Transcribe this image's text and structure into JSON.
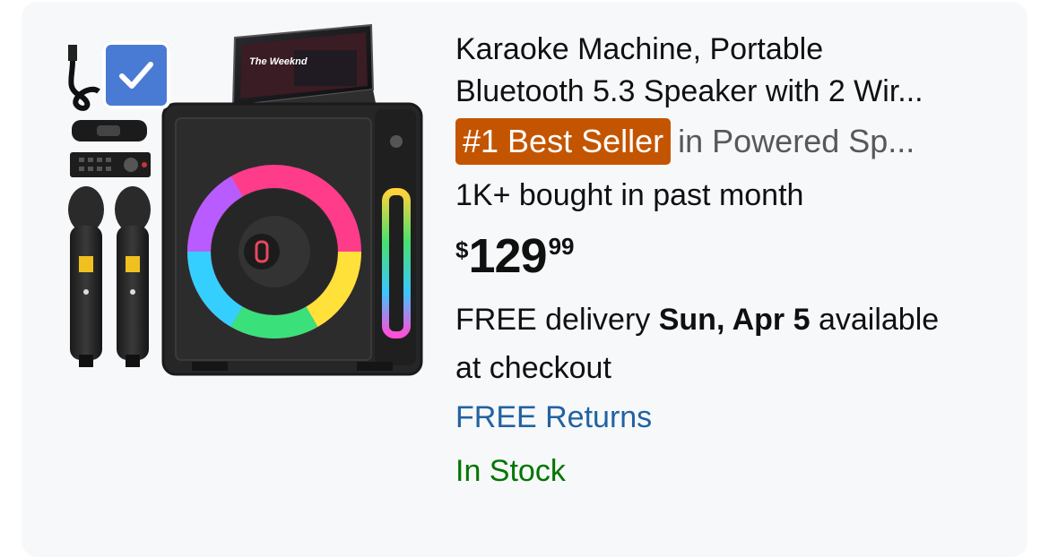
{
  "product": {
    "title_line1": "Karaoke Machine, Portable",
    "title_line2": "Bluetooth 5.3 Speaker with 2 Wir...",
    "badge": "#1 Best Seller",
    "category": "in Powered Sp...",
    "bought": "1K+ bought in past month",
    "price": {
      "symbol": "$",
      "whole": "129",
      "fraction": "99"
    },
    "delivery": {
      "prefix": "FREE delivery",
      "date": "Sun, Apr 5",
      "suffix_line1": "available",
      "suffix_line2": "at checkout"
    },
    "returns": "FREE Returns",
    "stock": "In Stock",
    "image": {
      "screen_text": "The Weeknd",
      "selected": true
    }
  },
  "colors": {
    "badge_bg": "#c45500",
    "link": "#2162a1",
    "in_stock": "#007600",
    "checkbox": "#4a7bd4",
    "card_bg": "#f7f8fa"
  },
  "icons": [
    "checkmark-icon",
    "usb-cable-icon",
    "remote-control-icon",
    "microphone-icon"
  ]
}
